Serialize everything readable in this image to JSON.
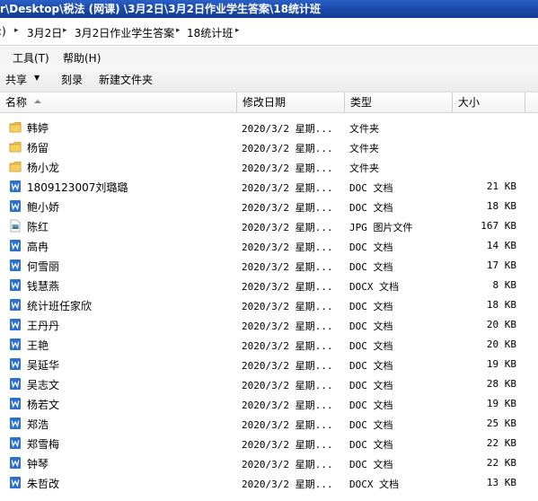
{
  "window": {
    "title": "r\\Desktop\\税法 (网课) \\3月2日\\3月2日作业学生答案\\18统计班"
  },
  "address": {
    "crumbs": [
      {
        "label": ":)"
      },
      {
        "label": "3月2日"
      },
      {
        "label": "3月2日作业学生答案"
      },
      {
        "label": "18统计班"
      }
    ]
  },
  "menu": {
    "tools": "工具(T)",
    "help": "帮助(H)"
  },
  "toolbar": {
    "share": "共享",
    "burn": "刻录",
    "new_folder": "新建文件夹"
  },
  "columns": {
    "name": "名称",
    "modified": "修改日期",
    "type": "类型",
    "size": "大小"
  },
  "files": [
    {
      "name": "韩婷",
      "date": "2020/3/2 星期...",
      "type": "文件夹",
      "size": "",
      "icon": "folder-icon"
    },
    {
      "name": "杨留",
      "date": "2020/3/2 星期...",
      "type": "文件夹",
      "size": "",
      "icon": "folder-icon"
    },
    {
      "name": "杨小龙",
      "date": "2020/3/2 星期...",
      "type": "文件夹",
      "size": "",
      "icon": "folder-icon"
    },
    {
      "name": "1809123007刘璐璐",
      "date": "2020/3/2 星期...",
      "type": "DOC 文档",
      "size": "21 KB",
      "icon": "word-doc-icon"
    },
    {
      "name": "鲍小娇",
      "date": "2020/3/2 星期...",
      "type": "DOC 文档",
      "size": "18 KB",
      "icon": "word-doc-icon"
    },
    {
      "name": "陈红",
      "date": "2020/3/2 星期...",
      "type": "JPG 图片文件",
      "size": "167 KB",
      "icon": "image-file-icon"
    },
    {
      "name": "高冉",
      "date": "2020/3/2 星期...",
      "type": "DOC 文档",
      "size": "14 KB",
      "icon": "word-doc-icon"
    },
    {
      "name": "何雪丽",
      "date": "2020/3/2 星期...",
      "type": "DOC 文档",
      "size": "17 KB",
      "icon": "word-doc-icon"
    },
    {
      "name": "钱慧燕",
      "date": "2020/3/2 星期...",
      "type": "DOCX 文档",
      "size": "8 KB",
      "icon": "word-doc-icon"
    },
    {
      "name": "统计班任家欣",
      "date": "2020/3/2 星期...",
      "type": "DOC 文档",
      "size": "18 KB",
      "icon": "word-doc-icon"
    },
    {
      "name": "王丹丹",
      "date": "2020/3/2 星期...",
      "type": "DOC 文档",
      "size": "20 KB",
      "icon": "word-doc-icon"
    },
    {
      "name": "王艳",
      "date": "2020/3/2 星期...",
      "type": "DOC 文档",
      "size": "20 KB",
      "icon": "word-doc-icon"
    },
    {
      "name": "吴延华",
      "date": "2020/3/2 星期...",
      "type": "DOC 文档",
      "size": "19 KB",
      "icon": "word-doc-icon"
    },
    {
      "name": "吴志文",
      "date": "2020/3/2 星期...",
      "type": "DOC 文档",
      "size": "28 KB",
      "icon": "word-doc-icon"
    },
    {
      "name": "杨若文",
      "date": "2020/3/2 星期...",
      "type": "DOC 文档",
      "size": "19 KB",
      "icon": "word-doc-icon"
    },
    {
      "name": "郑浩",
      "date": "2020/3/2 星期...",
      "type": "DOC 文档",
      "size": "25 KB",
      "icon": "word-doc-icon"
    },
    {
      "name": "郑雪梅",
      "date": "2020/3/2 星期...",
      "type": "DOC 文档",
      "size": "22 KB",
      "icon": "word-doc-icon"
    },
    {
      "name": "钟琴",
      "date": "2020/3/2 星期...",
      "type": "DOC 文档",
      "size": "22 KB",
      "icon": "word-doc-icon"
    },
    {
      "name": "朱哲改",
      "date": "2020/3/2 星期...",
      "type": "DOCX 文档",
      "size": "13 KB",
      "icon": "word-doc-icon"
    }
  ],
  "colors": {
    "title_bar": "#1b48a6",
    "folder": "#e8b94a",
    "word_icon": "#2b6fd6"
  }
}
